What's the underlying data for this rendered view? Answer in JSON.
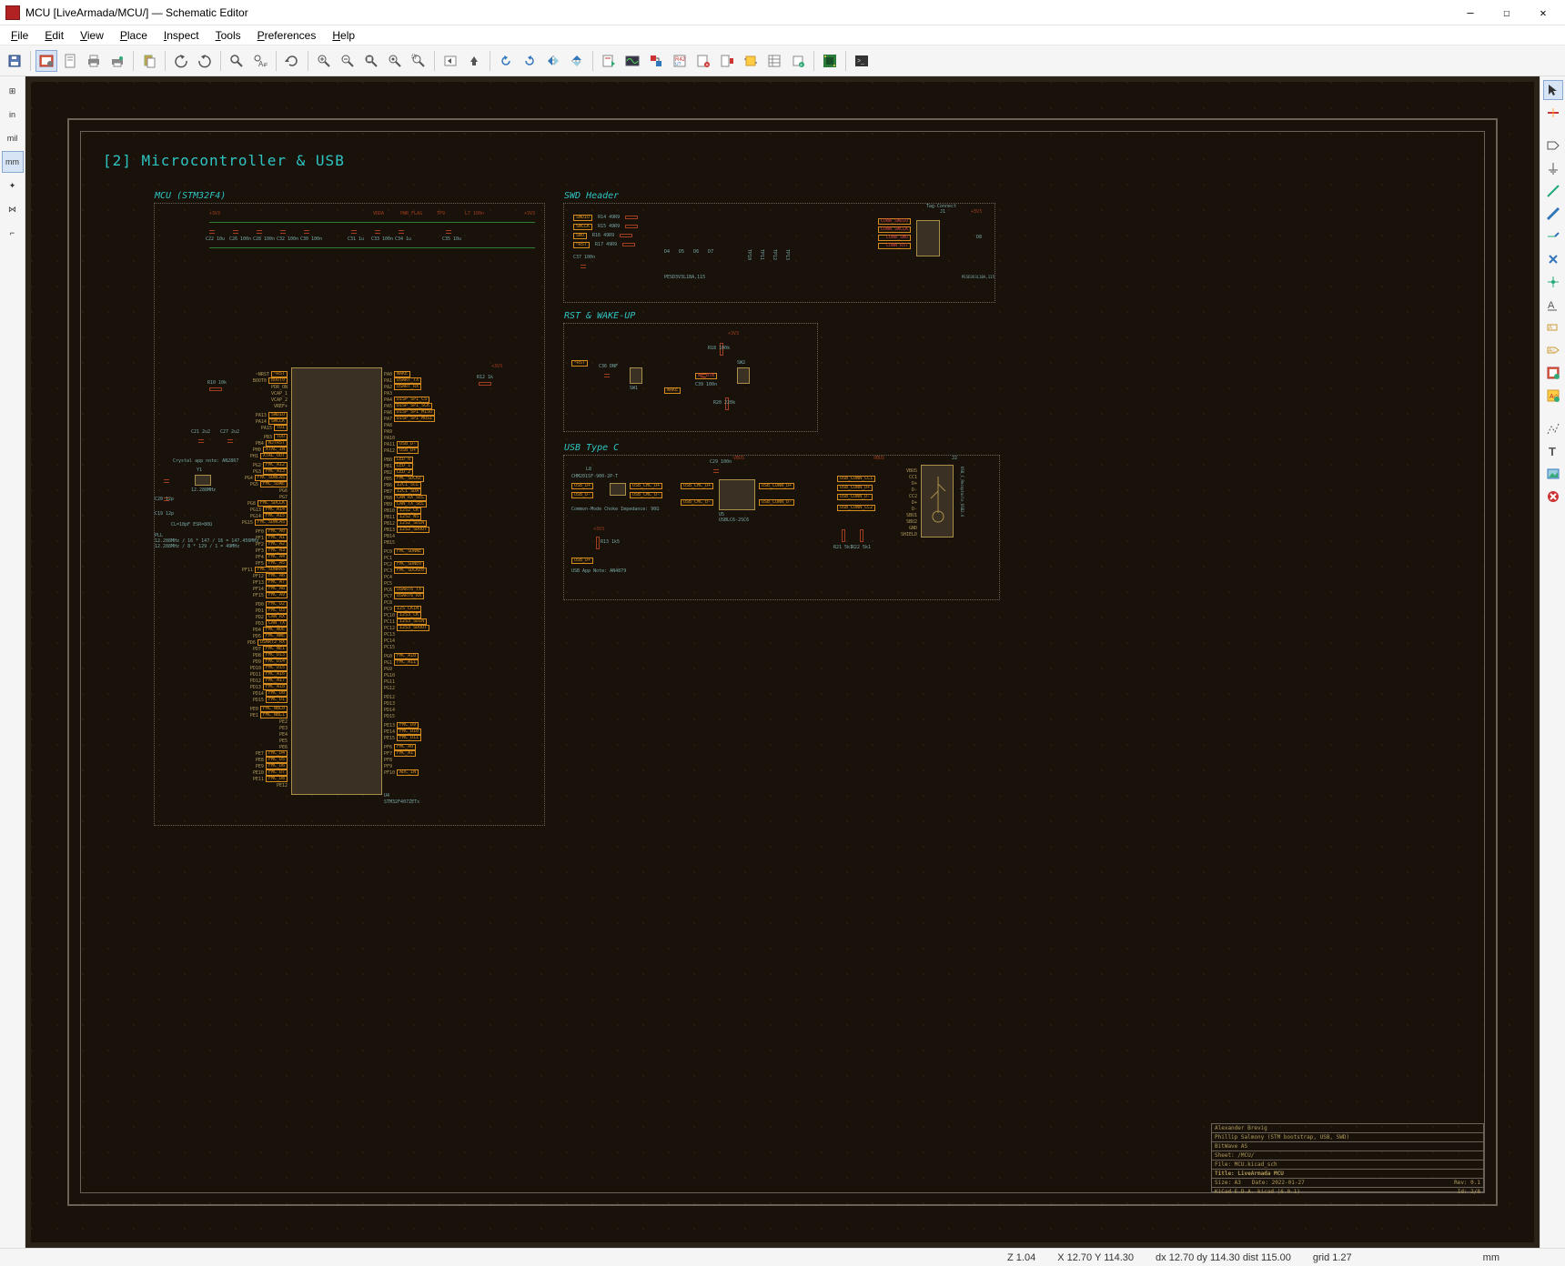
{
  "window": {
    "title": "MCU [LiveArmada/MCU/] — Schematic Editor",
    "min": "—",
    "max": "☐",
    "close": "✕"
  },
  "menus": [
    "File",
    "Edit",
    "View",
    "Place",
    "Inspect",
    "Tools",
    "Preferences",
    "Help"
  ],
  "ltool": [
    "⊞",
    "in",
    "mil",
    "mm",
    "✦",
    "⋈",
    "⌐"
  ],
  "ltool_active": 3,
  "rtool_active": 0,
  "page": {
    "title": "[2] Microcontroller & USB"
  },
  "blocks": {
    "mcu": {
      "title": "MCU (STM32F4)"
    },
    "swd": {
      "title": "SWD Header"
    },
    "rst": {
      "title": "RST & WAKE-UP"
    },
    "usb": {
      "title": "USB Type C"
    }
  },
  "mcu": {
    "ref": "U4",
    "part": "STM32F407ZETx",
    "vdd": "+3V3",
    "vdda": "VDDA",
    "pwrflag": "PWR_FLAG",
    "pwrtp": "TP9",
    "left_nets": [
      "~NRST",
      "BOOT0",
      "PDR_ON",
      "VCAP_1",
      "VCAP_2",
      "VREF+",
      "",
      "PA13",
      "PA14",
      "PA15",
      "",
      "PB3",
      "PB4",
      "PH0",
      "PH1",
      "",
      "PG2",
      "PG3",
      "PG4",
      "PG5",
      "PG6",
      "PG7",
      "PG8",
      "PG13",
      "PG14",
      "PG15",
      "",
      "PF0",
      "PF1",
      "PF2",
      "PF3",
      "PF4",
      "PF5",
      "PF11",
      "PF12",
      "PF13",
      "PF14",
      "PF15",
      "",
      "PD0",
      "PD1",
      "PD2",
      "PD3",
      "PD4",
      "PD5",
      "PD6",
      "PD7",
      "PD8",
      "PD9",
      "PD10",
      "PD11",
      "PD12",
      "PD13",
      "PD14",
      "PD15",
      "",
      "PE0",
      "PE1",
      "PE2",
      "PE3",
      "PE4",
      "PE5",
      "PE6",
      "PE7",
      "PE8",
      "PE9",
      "PE10",
      "PE11",
      "PE12"
    ],
    "left_labels": [
      "~RST",
      "BOOT0",
      "",
      "",
      "",
      "",
      "",
      "SWDIO",
      "SWCLK",
      "TDI",
      "",
      "TDO",
      "NJTRST",
      "XTAL_IN",
      "XTAL_OUT",
      "",
      "FMC_A12",
      "FMC_A13",
      "FMC_SDNCAS",
      "FMC_SDWE",
      "",
      "",
      "FMC_SDCLK",
      "FMC_A14",
      "FMC_A15",
      "FMC_SDNCAS",
      "",
      "FMC_A0",
      "FMC_A1",
      "FMC_A2",
      "FMC_A3",
      "FMC_A4",
      "FMC_A5",
      "FMC_SDNRAS",
      "FMC_A6",
      "FMC_A7",
      "FMC_A8",
      "FMC_A9",
      "",
      "FMC_D2",
      "FMC_D3",
      "CAN_RX",
      "CAN_TX",
      "FMC_NOE",
      "FMC_NWE",
      "USART2_RX",
      "FMC_NE1",
      "FMC_D13",
      "FMC_D14",
      "FMC_D15",
      "FMC_A16",
      "FMC_A17",
      "FMC_A18",
      "FMC_D0",
      "FMC_D1",
      "",
      "FMC_NBL0",
      "FMC_NBL1",
      "",
      "",
      "",
      "",
      "",
      "FMC_D4",
      "FMC_D5",
      "FMC_D6",
      "FMC_D7",
      "FMC_D8"
    ],
    "right_nets": [
      "PA0",
      "PA1",
      "PA2",
      "PA3",
      "PA4",
      "PA5",
      "PA6",
      "PA7",
      "PA8",
      "PA9",
      "PA10",
      "PA11",
      "PA12",
      "",
      "PB0",
      "PB1",
      "PB2",
      "PB5",
      "PB6",
      "PB7",
      "PB8",
      "PB9",
      "PB10",
      "PB11",
      "PB12",
      "PB13",
      "PB14",
      "PB15",
      "",
      "PC0",
      "PC1",
      "PC2",
      "PC3",
      "PC4",
      "PC5",
      "PC6",
      "PC7",
      "PC8",
      "PC9",
      "PC10",
      "PC11",
      "PC12",
      "PC13",
      "PC14",
      "PC15",
      "",
      "PG0",
      "PG1",
      "PG9",
      "PG10",
      "PG11",
      "PG12",
      "",
      "PD12",
      "PD13",
      "PD14",
      "PD15",
      "",
      "PE13",
      "PE14",
      "PE15",
      "",
      "PF6",
      "PF7",
      "PF8",
      "PF9",
      "PF10"
    ],
    "right_labels": [
      "WAKE",
      "USART_TX",
      "USART_RX",
      "",
      "DISP_SPI_CS",
      "DISP_SPI_SCK",
      "DISP_SPI_MISO",
      "DISP_SPI_MOSI",
      "",
      "",
      "",
      "USB_D-",
      "USB_D+",
      "",
      "LED_0",
      "LED_1",
      "LED_2",
      "FMC_SDCKE",
      "I2C1_SCL",
      "I2C1_SDA",
      "CAN_RX_SEL",
      "CAN_TX_SEL",
      "I2S2_CK",
      "I2S2_WS",
      "I2S2_SDIN",
      "I2S2_SDOUT",
      "",
      "",
      "",
      "FMC_SDNWE",
      "",
      "FMC_SDNE0",
      "FMC_SDCKE0",
      "",
      "",
      "USART6_TX",
      "USART6_RX",
      "",
      "I2S_CKIN",
      "I2S3_CK",
      "I2S3_SDIN",
      "I2S3_SDOUT",
      "",
      "",
      "",
      "",
      "FMC_A10",
      "FMC_A11",
      "",
      "",
      "",
      "",
      "",
      "",
      "",
      "",
      "",
      "",
      "FMC_D9",
      "FMC_D10",
      "FMC_D11",
      "",
      "FMC_A0",
      "FMC_A1",
      "",
      "",
      "ADC_IN"
    ],
    "top_caps": [
      "C22",
      "C26",
      "C28",
      "C32",
      "C30",
      "",
      "C31",
      "C33",
      "C34",
      "",
      "C35"
    ],
    "top_capvals": [
      "10u",
      "100n",
      "100n",
      "100n",
      "100n",
      "",
      "1u",
      "100n",
      "1u",
      "",
      "10u"
    ],
    "ferrite": "L7 100n",
    "boot_r": "R10 10k",
    "vcap_c": [
      "C21 2u2",
      "C27 2u2"
    ],
    "crystal_note": "Crystal app note: AN2867",
    "crystal": {
      "ref": "Y1",
      "val": "12.288MHz",
      "c": [
        "C20 12p",
        "C19 12p"
      ],
      "note": "CL=18pF ESR=80Ω"
    },
    "pll_note": "PLL\n12.288MHz / 16 * 147 / 16 = 147.456MHz\n12.288MHz / 8 * 129 / 1 = 49MHz"
  },
  "swd": {
    "r": [
      "R14 49R9",
      "R15 49R9",
      "R16 49R9",
      "R17 49R9"
    ],
    "nets_in": [
      "SWDIO",
      "SWCLK",
      "SWO",
      "~RST"
    ],
    "nets_out": [
      "CONN_SWDIO",
      "CONN_SWCLK",
      "CONN_SWO",
      "CONN_RST"
    ],
    "c": "C37 100n",
    "d": [
      "D4",
      "D5",
      "D6",
      "D7"
    ],
    "dpart": "PESD3V3L1BA,115",
    "tp": [
      "TP10",
      "TP11",
      "TP12",
      "TP13"
    ],
    "j": {
      "ref": "J1",
      "type": "Tag-Connect"
    },
    "d8": {
      "ref": "D8",
      "part": "PESD3V3L1BA,115"
    },
    "pwr": "+3V3"
  },
  "rst": {
    "nets": [
      "~RST",
      "WAKE",
      "WK_BTN"
    ],
    "sw": [
      "SW1",
      "SW2"
    ],
    "c": [
      "C36 DNF",
      "C39 100n"
    ],
    "r": [
      "R18 100k",
      "R20 220k"
    ],
    "pwr": "+3V3"
  },
  "usb": {
    "choke": {
      "ref": "L8",
      "part": "CHM201SF-900-2P-T",
      "note": "Common-Mode Choke Impedance: 90Ω"
    },
    "nets_in": [
      "USB_D+",
      "USB_D-"
    ],
    "nets_mid": [
      "USB_CMC_D+",
      "USB_CMC_D-"
    ],
    "esd": {
      "ref": "U5",
      "part": "USBLC6-2SC6",
      "c": "C29 100n",
      "pwr": "VBUS"
    },
    "nets_conn": [
      "USB_CONN_D+",
      "USB_CONN_D-",
      "USB_CONN_CC1",
      "USB_CONN_CC2"
    ],
    "cc_r": [
      "R21 5k1",
      "R22 5k1"
    ],
    "conn": {
      "ref": "J2",
      "type": "USB_C_Receptacle_USB2.0",
      "pins": [
        "VBUS",
        "CC1",
        "D+",
        "D-",
        "CC2",
        "D+",
        "D-",
        "SBU1",
        "SBU2",
        "GND",
        "SHIELD"
      ]
    },
    "pullup": {
      "r": "R13 1k5",
      "net": "USB_D+",
      "pwr": "+3V3"
    },
    "appnote": "USB App Note: AN4879"
  },
  "titleblock": {
    "l1": "Alexander Brevig",
    "l2": "Phillip Salmony (STM bootstrap, USB, SWD)",
    "l3": "BitWave AS",
    "l4": "Sheet: /MCU/",
    "l5": "File: MCU.kicad_sch",
    "title": "Title: LiveArmada MCU",
    "size": "Size: A3",
    "date": "Date: 2022-01-27",
    "rev": "Rev: 0.1",
    "tool": "KiCad E.D.A.  kicad (6.0.1)",
    "id": "Id: 2/8"
  },
  "status": {
    "zoom": "Z 1.04",
    "xy": "X 12.70  Y 114.30",
    "dxy": "dx 12.70  dy 114.30  dist 115.00",
    "grid": "grid 1.27",
    "unit": "mm"
  }
}
